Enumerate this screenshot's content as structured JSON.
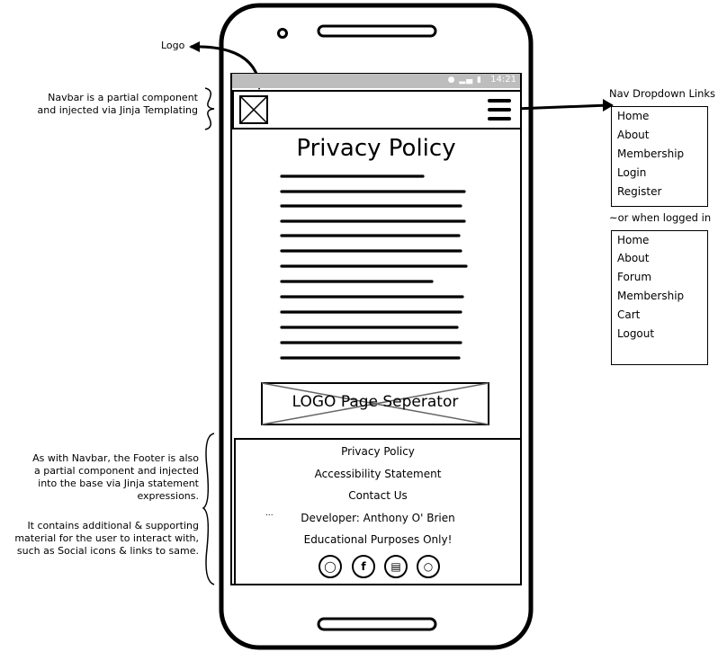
{
  "annotations": {
    "logo": "Logo",
    "navbar_line1": "Navbar is a partial component",
    "navbar_line2": "and injected via Jinja Templating",
    "nav_dropdown_title": "Nav Dropdown Links",
    "or_logged_in": "~or when logged in",
    "footer_para1": [
      "As with Navbar, the Footer is also",
      "a partial component and injected",
      "into the base via Jinja statement",
      "expressions."
    ],
    "footer_para2": [
      "It contains additional & supporting",
      "material for the user to interact with,",
      "such as Social icons & links to same."
    ],
    "ellipsis": "..."
  },
  "status_bar": {
    "time": "14:21",
    "icons": "wifi-icon signal-icon battery-icon"
  },
  "page": {
    "title": "Privacy Policy"
  },
  "separator": {
    "label": "LOGO Page Seperator"
  },
  "footer": {
    "links": [
      "Privacy Policy",
      "Accessibility Statement",
      "Contact Us",
      "Developer: Anthony O' Brien",
      "Educational Purposes Only!"
    ],
    "social_icons": [
      "instagram-icon",
      "facebook-icon",
      "map-icon",
      "github-icon"
    ]
  },
  "dropdown_logged_out": [
    "Home",
    "About",
    "Membership",
    "Login",
    "Register"
  ],
  "dropdown_logged_in": [
    "Home",
    "About",
    "Forum",
    "Membership",
    "Cart",
    "Logout"
  ]
}
